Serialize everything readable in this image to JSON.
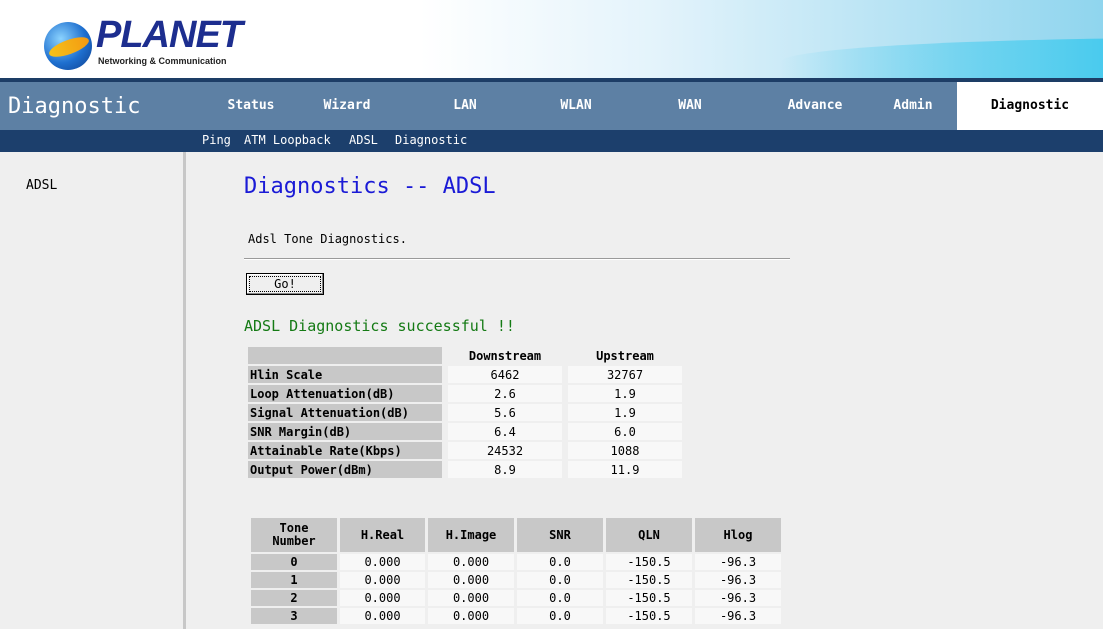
{
  "header": {
    "brand": "PLANET",
    "tagline": "Networking & Communication"
  },
  "nav": {
    "section_title": "Diagnostic",
    "tabs": [
      {
        "label": "Status"
      },
      {
        "label": "Wizard"
      },
      {
        "label": "LAN"
      },
      {
        "label": "WLAN"
      },
      {
        "label": "WAN"
      },
      {
        "label": "Advance"
      },
      {
        "label": "Admin"
      },
      {
        "label": "Diagnostic",
        "active": true
      }
    ],
    "sub_links": [
      {
        "label": "Ping"
      },
      {
        "label": "ATM Loopback"
      },
      {
        "label": "ADSL"
      },
      {
        "label": "Diagnostic"
      }
    ]
  },
  "sidebar": {
    "items": [
      {
        "label": "ADSL"
      }
    ]
  },
  "main": {
    "title": "Diagnostics -- ADSL",
    "description": "Adsl Tone Diagnostics.",
    "go_button": "Go!",
    "status_message": "ADSL Diagnostics successful !!",
    "stats": {
      "headers": [
        "",
        "Downstream",
        "Upstream"
      ],
      "rows": [
        {
          "label": "Hlin Scale",
          "down": "6462",
          "up": "32767"
        },
        {
          "label": "Loop Attenuation(dB)",
          "down": "2.6",
          "up": "1.9"
        },
        {
          "label": "Signal Attenuation(dB)",
          "down": "5.6",
          "up": "1.9"
        },
        {
          "label": "SNR Margin(dB)",
          "down": "6.4",
          "up": "6.0"
        },
        {
          "label": "Attainable Rate(Kbps)",
          "down": "24532",
          "up": "1088"
        },
        {
          "label": "Output Power(dBm)",
          "down": "8.9",
          "up": "11.9"
        }
      ]
    },
    "tones": {
      "headers": [
        "Tone Number",
        "H.Real",
        "H.Image",
        "SNR",
        "QLN",
        "Hlog"
      ],
      "rows": [
        [
          "0",
          "0.000",
          "0.000",
          "0.0",
          "-150.5",
          "-96.3"
        ],
        [
          "1",
          "0.000",
          "0.000",
          "0.0",
          "-150.5",
          "-96.3"
        ],
        [
          "2",
          "0.000",
          "0.000",
          "0.0",
          "-150.5",
          "-96.3"
        ],
        [
          "3",
          "0.000",
          "0.000",
          "0.0",
          "-150.5",
          "-96.3"
        ]
      ]
    }
  },
  "colors": {
    "nav_bg": "#5d80a4",
    "subnav_bg": "#1c3f6c",
    "title_blue": "#1a1ad6",
    "success_green": "#147a14"
  }
}
